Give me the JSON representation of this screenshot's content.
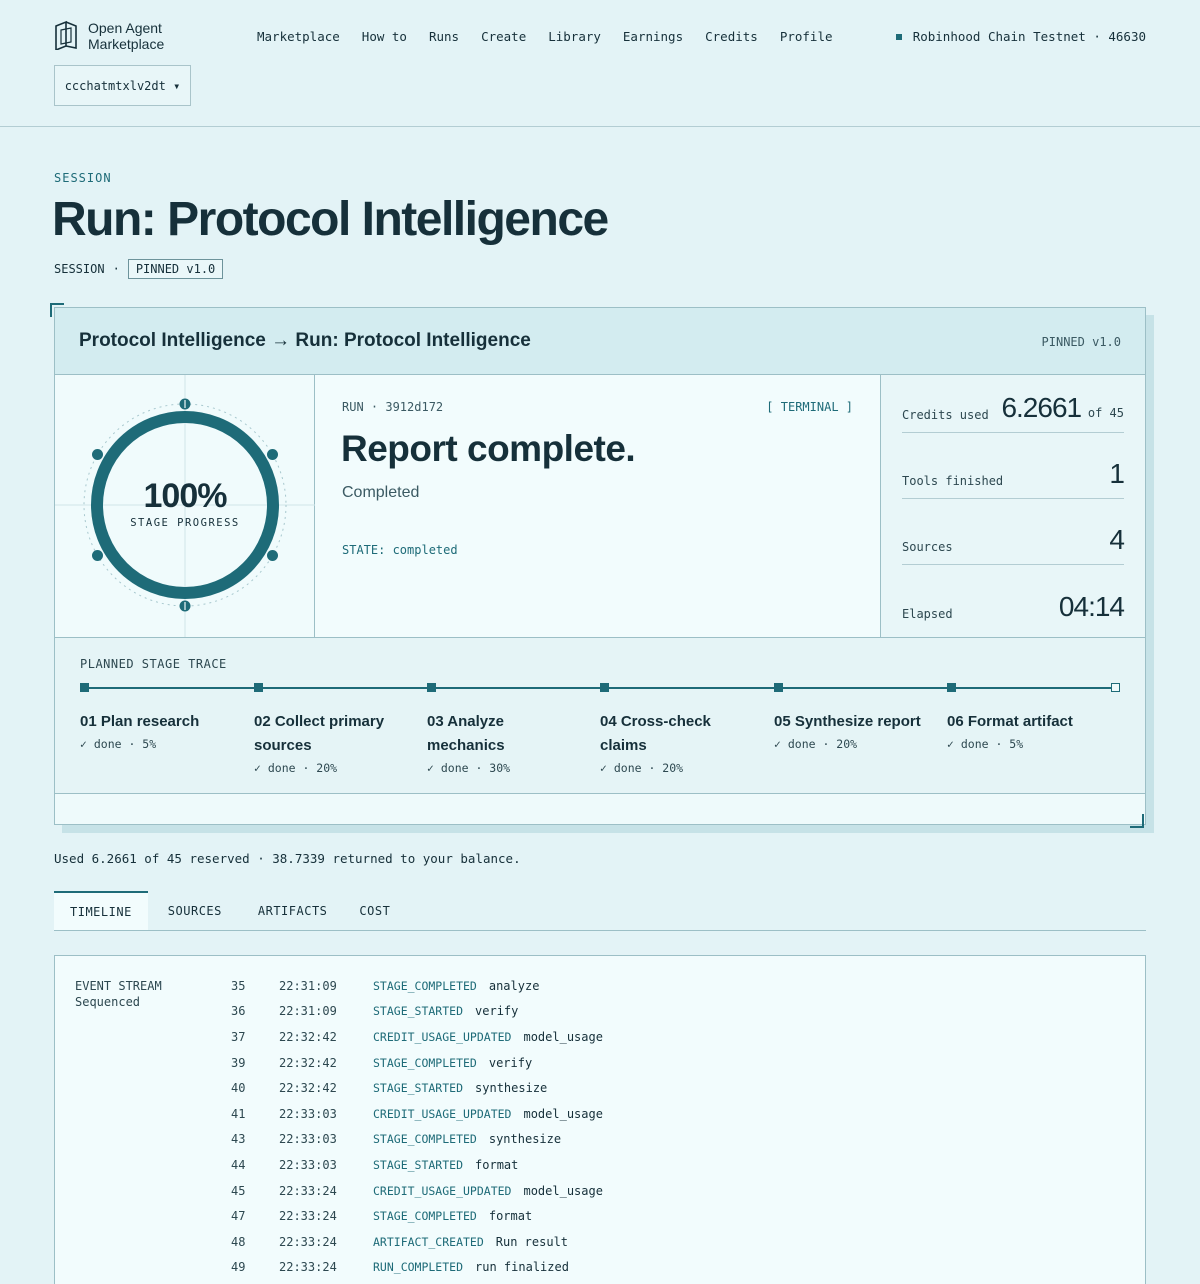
{
  "header": {
    "logo_line1": "Open Agent",
    "logo_line2": "Marketplace",
    "nav": [
      "Marketplace",
      "How to",
      "Runs",
      "Create",
      "Library",
      "Earnings",
      "Credits",
      "Profile"
    ],
    "chain": "Robinhood Chain Testnet · 46630",
    "account": "ccchatmtxlv2dt ▾"
  },
  "page": {
    "kicker": "SESSION",
    "title": "Run: Protocol Intelligence",
    "sub_label": "SESSION",
    "sub_sep": "·",
    "pinned": "PINNED v1.0"
  },
  "card": {
    "title": "Protocol Intelligence → Run: Protocol Intelligence",
    "version": "PINNED v1.0",
    "gauge_pct": "100%",
    "gauge_label": "STAGE PROGRESS",
    "progress": 1.0,
    "run_id": "RUN · 3912d172",
    "terminal": "[ TERMINAL ]",
    "headline": "Report complete.",
    "status": "Completed",
    "state": "STATE: completed",
    "metrics": [
      {
        "label": "Credits used",
        "value": "6.2661",
        "suffix": "of 45"
      },
      {
        "label": "Tools finished",
        "value": "1",
        "suffix": ""
      },
      {
        "label": "Sources",
        "value": "4",
        "suffix": ""
      },
      {
        "label": "Elapsed",
        "value": "04:14",
        "suffix": ""
      }
    ],
    "trace_title": "PLANNED STAGE TRACE",
    "stages": [
      {
        "name": "01 Plan research",
        "status": "✓ done · 5%"
      },
      {
        "name": "02 Collect primary sources",
        "status": "✓ done · 20%"
      },
      {
        "name": "03 Analyze mechanics",
        "status": "✓ done · 30%"
      },
      {
        "name": "04 Cross-check claims",
        "status": "✓ done · 20%"
      },
      {
        "name": "05 Synthesize report",
        "status": "✓ done · 20%"
      },
      {
        "name": "06 Format artifact",
        "status": "✓ done · 5%"
      }
    ]
  },
  "balance": "Used 6.2661 of 45 reserved · 38.7339 returned to your balance.",
  "tabs": [
    "TIMELINE",
    "SOURCES",
    "ARTIFACTS",
    "COST"
  ],
  "stream": {
    "label1": "EVENT STREAM",
    "label2": "Sequenced",
    "rows": [
      {
        "seq": "35",
        "time": "22:31:09",
        "type": "STAGE_COMPLETED",
        "detail": "analyze"
      },
      {
        "seq": "36",
        "time": "22:31:09",
        "type": "STAGE_STARTED",
        "detail": "verify"
      },
      {
        "seq": "37",
        "time": "22:32:42",
        "type": "CREDIT_USAGE_UPDATED",
        "detail": "model_usage"
      },
      {
        "seq": "39",
        "time": "22:32:42",
        "type": "STAGE_COMPLETED",
        "detail": "verify"
      },
      {
        "seq": "40",
        "time": "22:32:42",
        "type": "STAGE_STARTED",
        "detail": "synthesize"
      },
      {
        "seq": "41",
        "time": "22:33:03",
        "type": "CREDIT_USAGE_UPDATED",
        "detail": "model_usage"
      },
      {
        "seq": "43",
        "time": "22:33:03",
        "type": "STAGE_COMPLETED",
        "detail": "synthesize"
      },
      {
        "seq": "44",
        "time": "22:33:03",
        "type": "STAGE_STARTED",
        "detail": "format"
      },
      {
        "seq": "45",
        "time": "22:33:24",
        "type": "CREDIT_USAGE_UPDATED",
        "detail": "model_usage"
      },
      {
        "seq": "47",
        "time": "22:33:24",
        "type": "STAGE_COMPLETED",
        "detail": "format"
      },
      {
        "seq": "48",
        "time": "22:33:24",
        "type": "ARTIFACT_CREATED",
        "detail": "Run result"
      },
      {
        "seq": "49",
        "time": "22:33:24",
        "type": "RUN_COMPLETED",
        "detail": "run finalized"
      }
    ]
  }
}
